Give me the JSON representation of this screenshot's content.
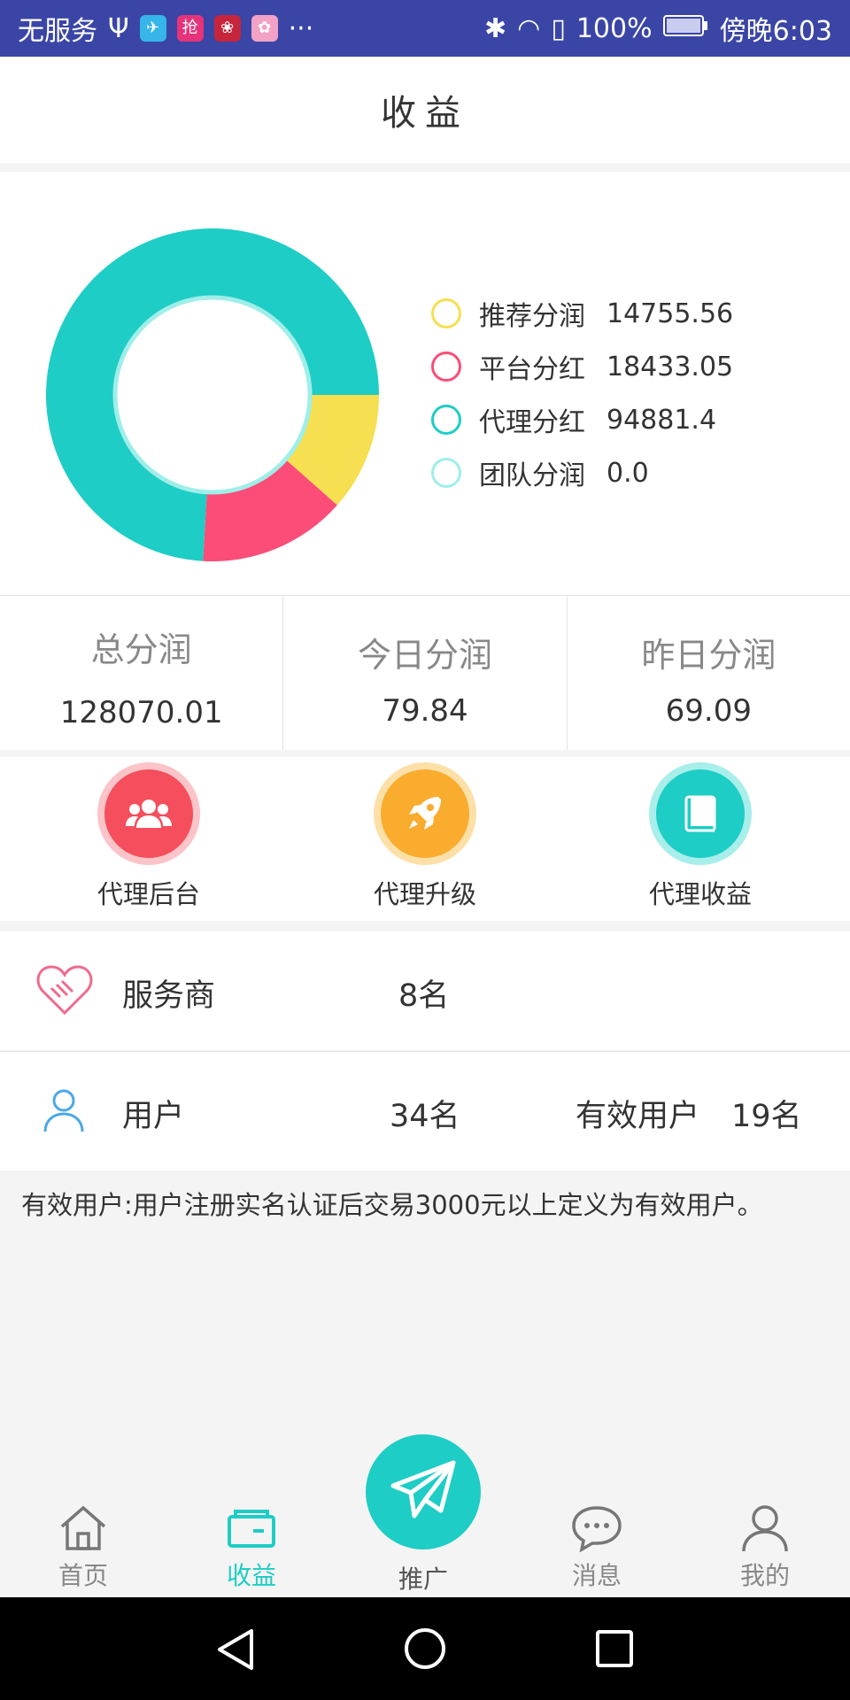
{
  "status_bar": {
    "carrier": "无服务",
    "battery": "100%",
    "time": "傍晚6:03"
  },
  "header": {
    "title": "收益"
  },
  "chart_data": {
    "type": "pie",
    "categories": [
      "推荐分润",
      "平台分红",
      "代理分红",
      "团队分润"
    ],
    "values": [
      14755.56,
      18433.05,
      94881.4,
      0.0
    ],
    "value_labels": [
      "14755.56",
      "18433.05",
      "94881.4",
      "0.0"
    ],
    "colors": [
      "#f6df50",
      "#fb4d78",
      "#1ecdc5",
      "#9feee9"
    ],
    "donut": true,
    "legend_position": "right"
  },
  "stats": [
    {
      "title": "总分润",
      "value": "128070.01"
    },
    {
      "title": "今日分润",
      "value": "79.84"
    },
    {
      "title": "昨日分润",
      "value": "69.09"
    }
  ],
  "quick_actions": [
    {
      "label": "代理后台",
      "icon": "group-icon",
      "color": "#f54e5c"
    },
    {
      "label": "代理升级",
      "icon": "rocket-icon",
      "color": "#f9ac2d"
    },
    {
      "label": "代理收益",
      "icon": "book-icon",
      "color": "#1ecdc5"
    }
  ],
  "service": {
    "label": "服务商",
    "count": "8名",
    "icon": "handshake-heart-icon"
  },
  "users": {
    "label": "用户",
    "count": "34名",
    "valid_label": "有效用户",
    "valid_count": "19名",
    "icon": "user-icon"
  },
  "note": "有效用户:用户注册实名认证后交易3000元以上定义为有效用户。",
  "tabs": [
    {
      "label": "首页",
      "icon": "home-icon"
    },
    {
      "label": "收益",
      "icon": "wallet-icon",
      "active": true
    },
    {
      "label": "推广",
      "icon": "paper-plane-icon"
    },
    {
      "label": "消息",
      "icon": "chat-icon"
    },
    {
      "label": "我的",
      "icon": "profile-icon"
    }
  ]
}
